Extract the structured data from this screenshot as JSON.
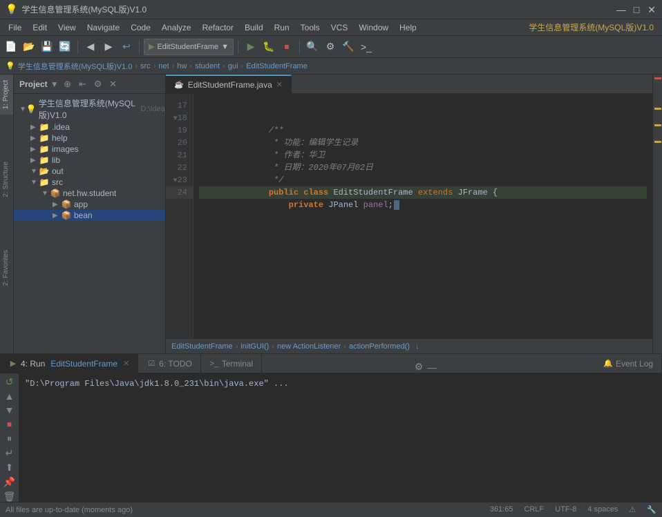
{
  "titlebar": {
    "title": "学生信息管理系统(MySQL版)V1.0",
    "full_title": "学生信息管理系统(MySQL版)V1.0",
    "controls": [
      "—",
      "□",
      "✕"
    ]
  },
  "menubar": {
    "items": [
      "File",
      "Edit",
      "View",
      "Navigate",
      "Code",
      "Analyze",
      "Refactor",
      "Build",
      "Run",
      "Tools",
      "VCS",
      "Window",
      "Help",
      "学生信息管理系统(MySQL版)V1.0"
    ]
  },
  "toolbar": {
    "dropdown_label": "EditStudentFrame",
    "dropdown_arrow": "▼"
  },
  "breadcrumb": {
    "items": [
      "学生信息管理系统(MySQL版)V1.0",
      "src",
      "net",
      "hw",
      "student",
      "gui",
      "EditStudentFrame"
    ]
  },
  "project_panel": {
    "title": "Project",
    "root": {
      "label": "学生信息管理系统(MySQL版)V1.0",
      "path": "D:\\Idea",
      "children": [
        {
          "label": ".idea",
          "type": "folder",
          "indent": 1
        },
        {
          "label": "help",
          "type": "folder",
          "indent": 1
        },
        {
          "label": "images",
          "type": "folder",
          "indent": 1
        },
        {
          "label": "lib",
          "type": "folder",
          "indent": 1
        },
        {
          "label": "out",
          "type": "folder",
          "indent": 1,
          "open": true
        },
        {
          "label": "src",
          "type": "folder",
          "indent": 1,
          "open": true,
          "children": [
            {
              "label": "net.hw.student",
              "type": "folder",
              "indent": 2,
              "open": true,
              "children": [
                {
                  "label": "app",
                  "type": "folder",
                  "indent": 3
                },
                {
                  "label": "bean",
                  "type": "folder",
                  "indent": 3,
                  "selected": true
                }
              ]
            }
          ]
        }
      ]
    }
  },
  "editor": {
    "tab_label": "EditStudentFrame.java",
    "lines": [
      {
        "num": "17",
        "content": ""
      },
      {
        "num": "18",
        "content": "    /**",
        "type": "comment"
      },
      {
        "num": "19",
        "content": "     * 功能：编辑学生记录",
        "type": "cn-comment"
      },
      {
        "num": "20",
        "content": "     * 作者：华卫",
        "type": "cn-comment"
      },
      {
        "num": "21",
        "content": "     * 日期：2020年07月02日",
        "type": "cn-comment"
      },
      {
        "num": "22",
        "content": "     */",
        "type": "comment"
      },
      {
        "num": "23",
        "content": "    public class EditStudentFrame extends JFrame {",
        "type": "code"
      },
      {
        "num": "24",
        "content": "        private JPanel panel;",
        "type": "code",
        "highlighted": true
      }
    ],
    "breadcrumb": "EditStudentFrame › initGUI() › new ActionListener › actionPerformed()"
  },
  "run_panel": {
    "tab_label": "EditStudentFrame",
    "output_line": "\"D:\\Program Files\\Java\\jdk1.8.0_231\\bin\\java.exe\" ..."
  },
  "bottom_tabs": [
    {
      "label": "4: Run",
      "icon": "▶",
      "active": true
    },
    {
      "label": "6: TODO",
      "icon": "☑",
      "active": false
    },
    {
      "label": "Terminal",
      "icon": ">_",
      "active": false
    },
    {
      "label": "Event Log",
      "icon": "🔔",
      "active": false
    }
  ],
  "statusbar": {
    "left": "All files are up-to-date (moments ago)",
    "position": "361:65",
    "crlf": "CRLF",
    "encoding": "UTF-8",
    "indent": "4 spaces"
  }
}
